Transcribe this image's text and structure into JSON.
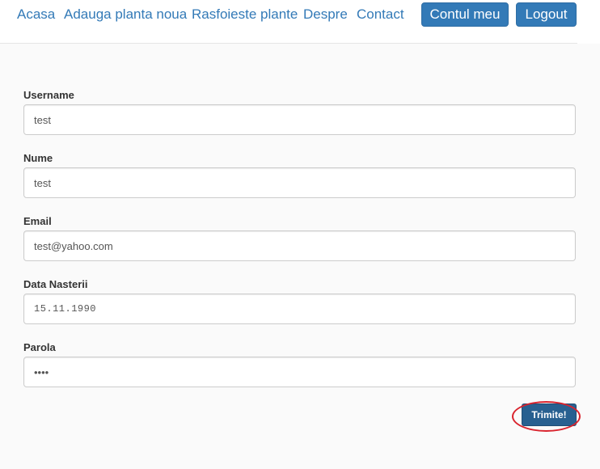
{
  "nav": {
    "links": [
      "Acasa",
      "Adauga planta noua",
      "Rasfoieste plante",
      "Despre",
      "Contact"
    ],
    "account_button": "Contul meu",
    "logout_button": "Logout"
  },
  "form": {
    "fields": [
      {
        "label": "Username",
        "value": "test",
        "type": "text"
      },
      {
        "label": "Nume",
        "value": "test",
        "type": "text"
      },
      {
        "label": "Email",
        "value": "test@yahoo.com",
        "type": "text"
      },
      {
        "label": "Data Nasterii",
        "value": "15.11.1990",
        "type": "date"
      },
      {
        "label": "Parola",
        "value": "test",
        "type": "password"
      }
    ],
    "submit_label": "Trimite!"
  },
  "colors": {
    "link": "#337ab7",
    "primary_button": "#337ab7",
    "submit_button": "#286090",
    "highlight": "#d9232d"
  }
}
